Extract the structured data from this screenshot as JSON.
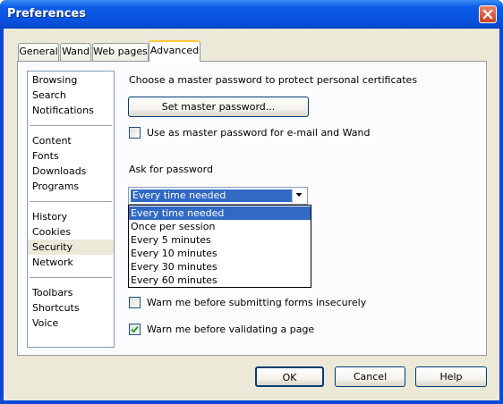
{
  "window": {
    "title": "Preferences"
  },
  "tabs": [
    {
      "label": "General"
    },
    {
      "label": "Wand"
    },
    {
      "label": "Web pages"
    },
    {
      "label": "Advanced"
    }
  ],
  "sidebar": {
    "groups": [
      [
        "Browsing",
        "Search",
        "Notifications"
      ],
      [
        "Content",
        "Fonts",
        "Downloads",
        "Programs"
      ],
      [
        "History",
        "Cookies",
        "Security",
        "Network"
      ],
      [
        "Toolbars",
        "Shortcuts",
        "Voice"
      ]
    ],
    "selected": "Security"
  },
  "security": {
    "master_password_text": "Choose a master password to protect personal certificates",
    "set_master_password_button": "Set master password...",
    "use_master_for_email_label": "Use as master password for e-mail and Wand",
    "use_master_for_email_checked": false,
    "ask_for_password_label": "Ask for password",
    "ask_for_password_value": "Every time needed",
    "ask_for_password_options": [
      "Every time needed",
      "Once per session",
      "Every 5 minutes",
      "Every 10 minutes",
      "Every 30 minutes",
      "Every 60 minutes"
    ],
    "warn_insecure_forms_label": "Warn me before submitting forms insecurely",
    "warn_insecure_forms_checked": false,
    "warn_validating_label": "Warn me before validating a page",
    "warn_validating_checked": true
  },
  "footer": {
    "ok": "OK",
    "cancel": "Cancel",
    "help": "Help"
  },
  "colors": {
    "titlebar": "#0a5ce8",
    "selection": "#316ac5",
    "dialog_bg": "#ece9d8"
  }
}
